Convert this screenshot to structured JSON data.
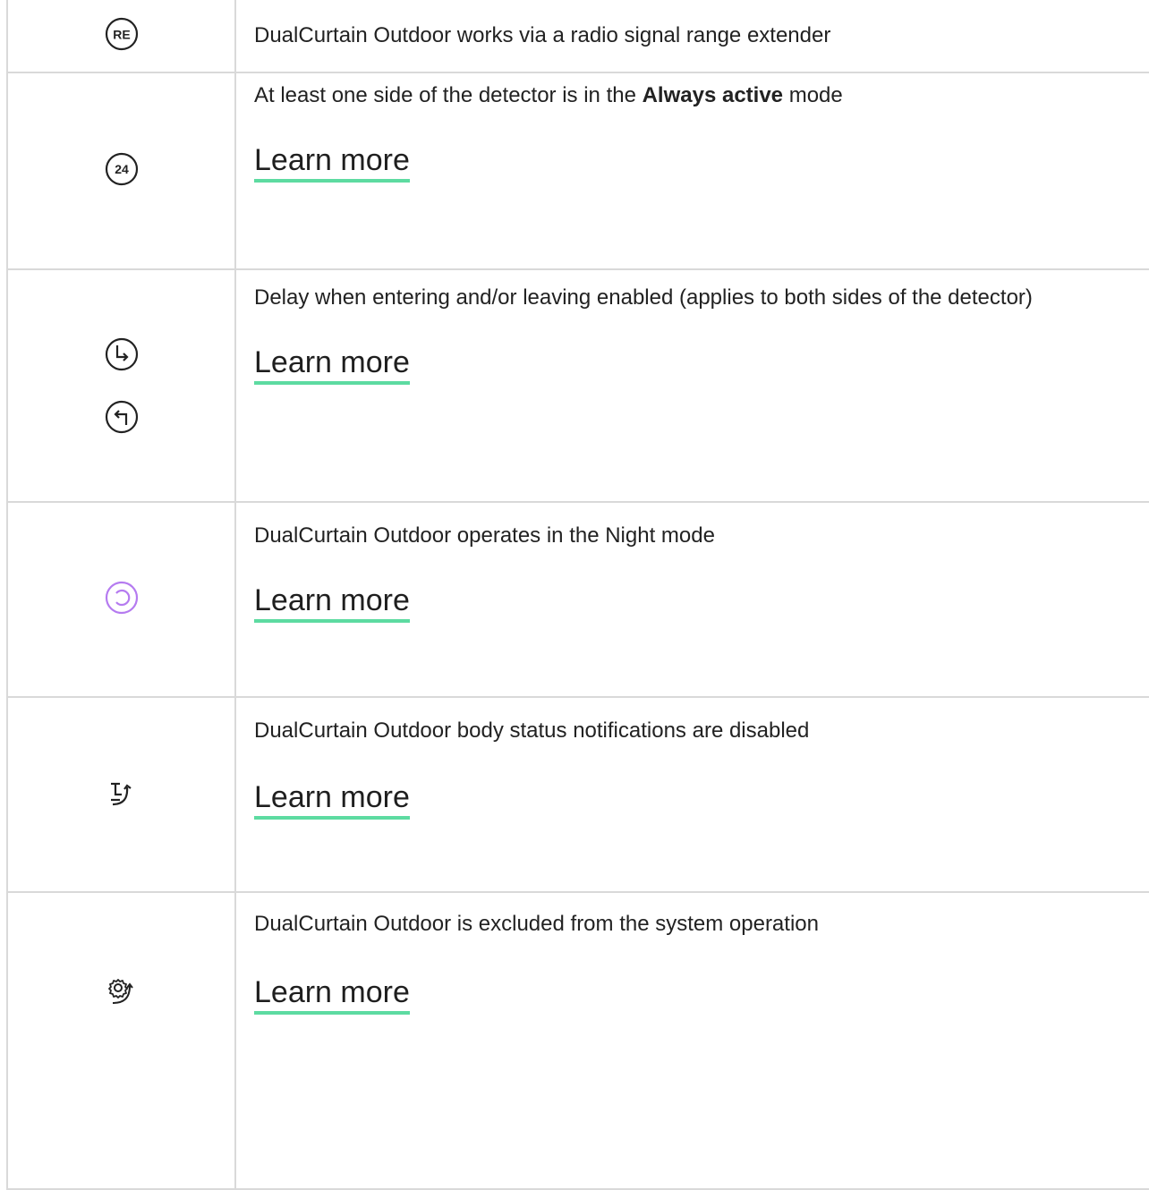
{
  "rows": [
    {
      "icon": "re-icon",
      "icon_label": "RE",
      "text": "DualCurtain Outdoor works via a radio signal range extender"
    },
    {
      "icon": "24-hour-icon",
      "icon_label": "24",
      "text_before": "At least one side of the detector is in the ",
      "text_bold": "Always active",
      "text_after": " mode",
      "link": "Learn more"
    },
    {
      "icon": "entry-exit-delay-icons",
      "text": "Delay when entering and/or leaving enabled (applies to both sides of the detector)",
      "link": "Learn more"
    },
    {
      "icon": "night-mode-icon",
      "text": "DualCurtain Outdoor operates in the Night mode",
      "link": "Learn more"
    },
    {
      "icon": "tamper-notifications-off-icon",
      "text": "DualCurtain Outdoor body status notifications are disabled",
      "link": "Learn more"
    },
    {
      "icon": "excluded-from-system-icon",
      "text": "DualCurtain Outdoor is excluded from the system operation",
      "link": "Learn more"
    }
  ],
  "colors": {
    "link_underline": "#5ddba1",
    "night_icon": "#b57bf0",
    "border": "#d9d9d9"
  }
}
